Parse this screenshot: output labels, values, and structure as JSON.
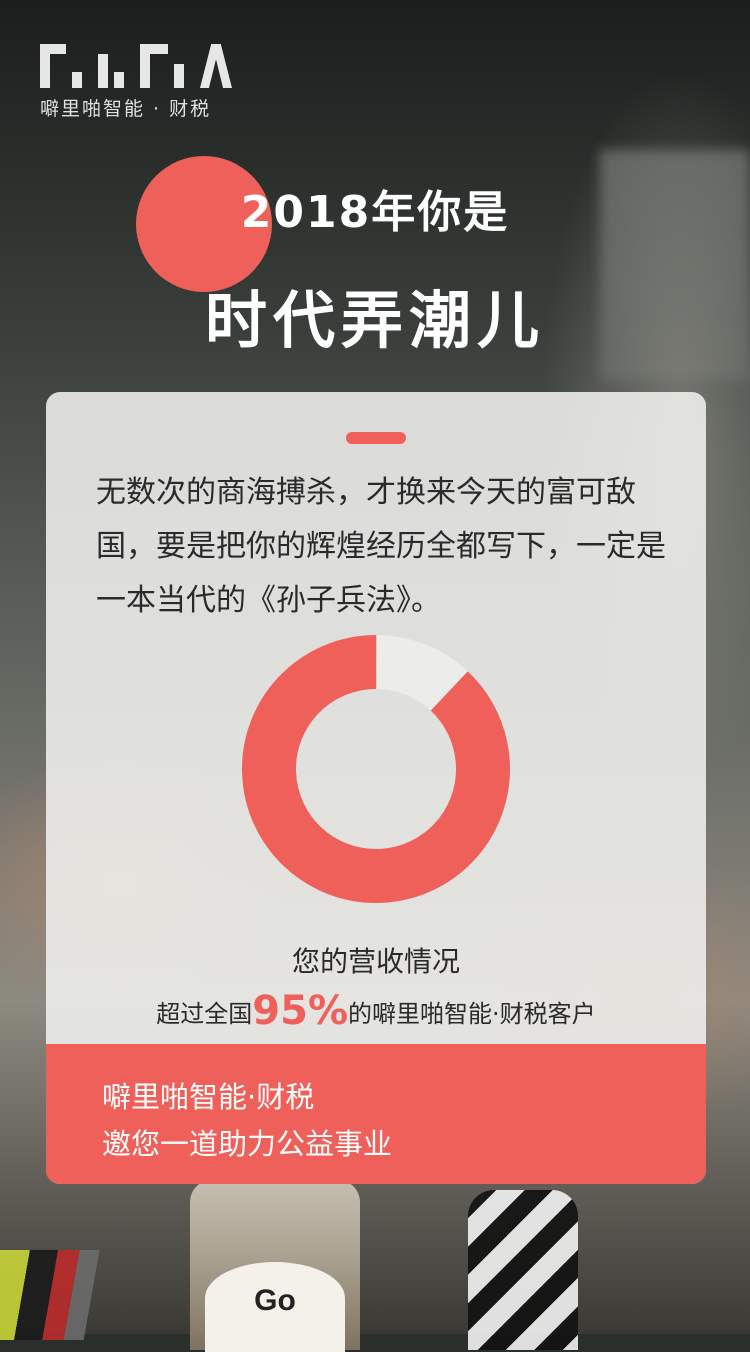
{
  "brand": {
    "logo_mark": "PiliPa",
    "name": "噼里啪智能 · 财税"
  },
  "headline": {
    "line1": "2018年你是",
    "line2": "时代弄潮儿"
  },
  "card": {
    "paragraph": "无数次的商海搏杀，才换来今天的富可敌国，要是把你的辉煌经历全都写下，一定是一本当代的《孙子兵法》。",
    "donut_percent": 95,
    "stat_title": "您的营收情况",
    "stat_prefix": "超过全国",
    "stat_value": "95%",
    "stat_suffix": "的噼里啪智能·财税客户",
    "footer_line1": "噼里啪智能·财税",
    "footer_line2": "邀您一道助力公益事业"
  },
  "background": {
    "jar_label": "Go"
  },
  "colors": {
    "accent": "#f0605a",
    "track": "#ececea",
    "text": "#2a2a2a"
  }
}
